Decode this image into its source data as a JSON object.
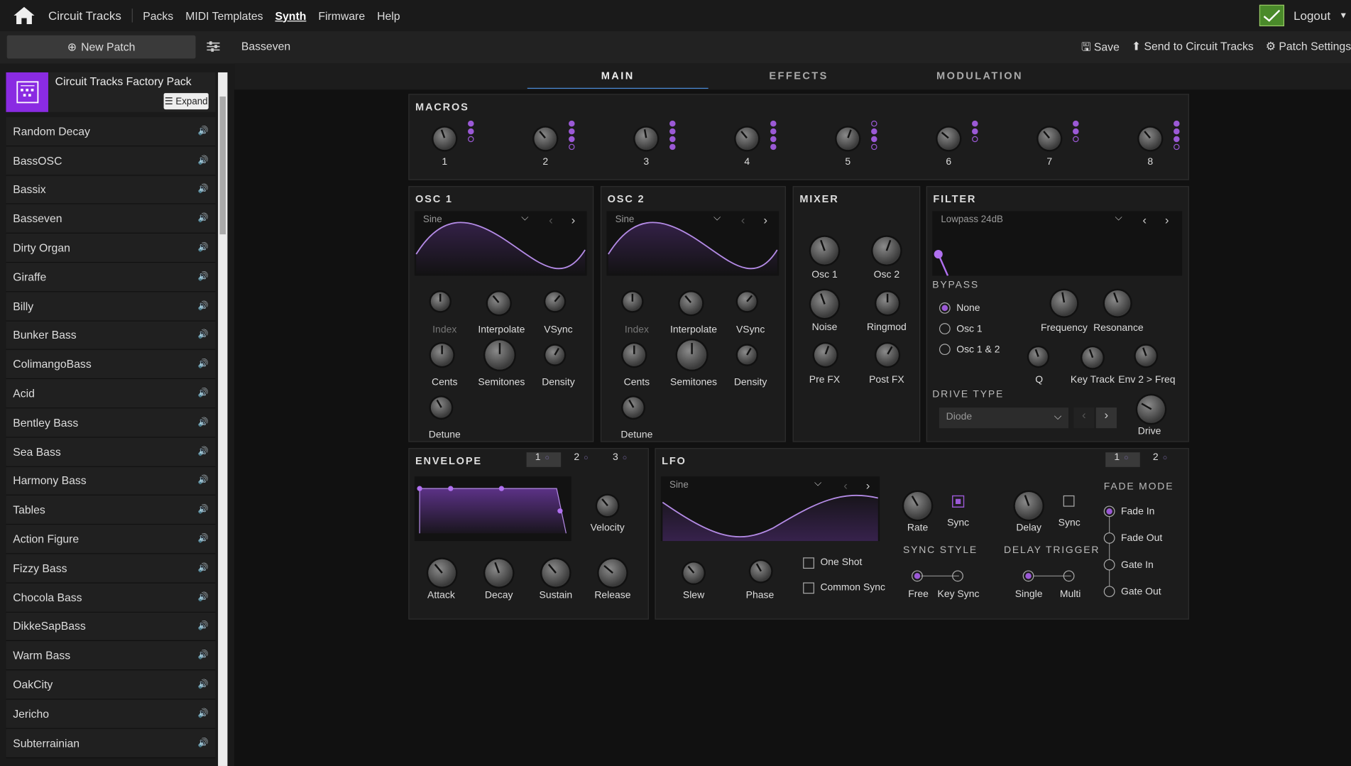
{
  "nav": {
    "brand": "Circuit Tracks",
    "items": [
      "Packs",
      "MIDI Templates",
      "Synth",
      "Firmware",
      "Help"
    ],
    "active": "Synth",
    "logout": "Logout"
  },
  "subbar": {
    "new_patch": "New Patch",
    "patch_name": "Basseven",
    "save": "Save",
    "send": "Send to Circuit Tracks",
    "settings": "Patch Settings"
  },
  "pack": {
    "name": "Circuit Tracks Factory Pack",
    "expand": "Expand"
  },
  "patches": [
    "Random Decay",
    "BassOSC",
    "Bassix",
    "Basseven",
    "Dirty Organ",
    "Giraffe",
    "Billy",
    "Bunker Bass",
    "ColimangoBass",
    "Acid",
    "Bentley Bass",
    "Sea Bass",
    "Harmony Bass",
    "Tables",
    "Action Figure",
    "Fizzy Bass",
    "Chocola Bass",
    "DikkeSapBass",
    "Warm Bass",
    "OakCity",
    "Jericho",
    "Subterrainian"
  ],
  "tabs": [
    "MAIN",
    "EFFECTS",
    "MODULATION"
  ],
  "macros": {
    "title": "MACROS",
    "labels": [
      "1",
      "2",
      "3",
      "4",
      "5",
      "6",
      "7",
      "8"
    ]
  },
  "osc1": {
    "title": "OSC 1",
    "wave": "Sine",
    "labels": [
      "Index",
      "Interpolate",
      "VSync",
      "Cents",
      "Semitones",
      "Density",
      "Detune"
    ]
  },
  "osc2": {
    "title": "OSC 2",
    "wave": "Sine",
    "labels": [
      "Index",
      "Interpolate",
      "VSync",
      "Cents",
      "Semitones",
      "Density",
      "Detune"
    ]
  },
  "mixer": {
    "title": "MIXER",
    "labels": [
      "Osc 1",
      "Osc 2",
      "Noise",
      "Ringmod",
      "Pre FX",
      "Post FX"
    ]
  },
  "filter": {
    "title": "FILTER",
    "type": "Lowpass 24dB",
    "bypass": "BYPASS",
    "options": [
      "None",
      "Osc 1",
      "Osc 1 & 2"
    ],
    "labels": [
      "Frequency",
      "Resonance",
      "Q",
      "Key Track",
      "Env 2 > Freq",
      "Drive"
    ],
    "drive_type": "DRIVE TYPE",
    "drive_value": "Diode"
  },
  "envelope": {
    "title": "ENVELOPE",
    "tabs": [
      "1",
      "2",
      "3"
    ],
    "labels": [
      "Velocity",
      "Attack",
      "Decay",
      "Sustain",
      "Release"
    ]
  },
  "lfo": {
    "title": "LFO",
    "tabs": [
      "1",
      "2"
    ],
    "wave": "Sine",
    "labels": [
      "Slew",
      "Phase",
      "Rate",
      "Sync",
      "Delay",
      "Sync"
    ],
    "one_shot": "One Shot",
    "common_sync": "Common Sync",
    "sync_style": "SYNC STYLE",
    "sync_opts": [
      "Free",
      "Key Sync"
    ],
    "delay_trigger": "DELAY TRIGGER",
    "trig_opts": [
      "Single",
      "Multi"
    ],
    "fade_mode": "FADE MODE",
    "fade_opts": [
      "Fade In",
      "Fade Out",
      "Gate In",
      "Gate Out"
    ]
  },
  "colors": {
    "accent": "#8a2be2",
    "purple": "#9b59d6",
    "tab_underline": "#4a8ad8"
  }
}
